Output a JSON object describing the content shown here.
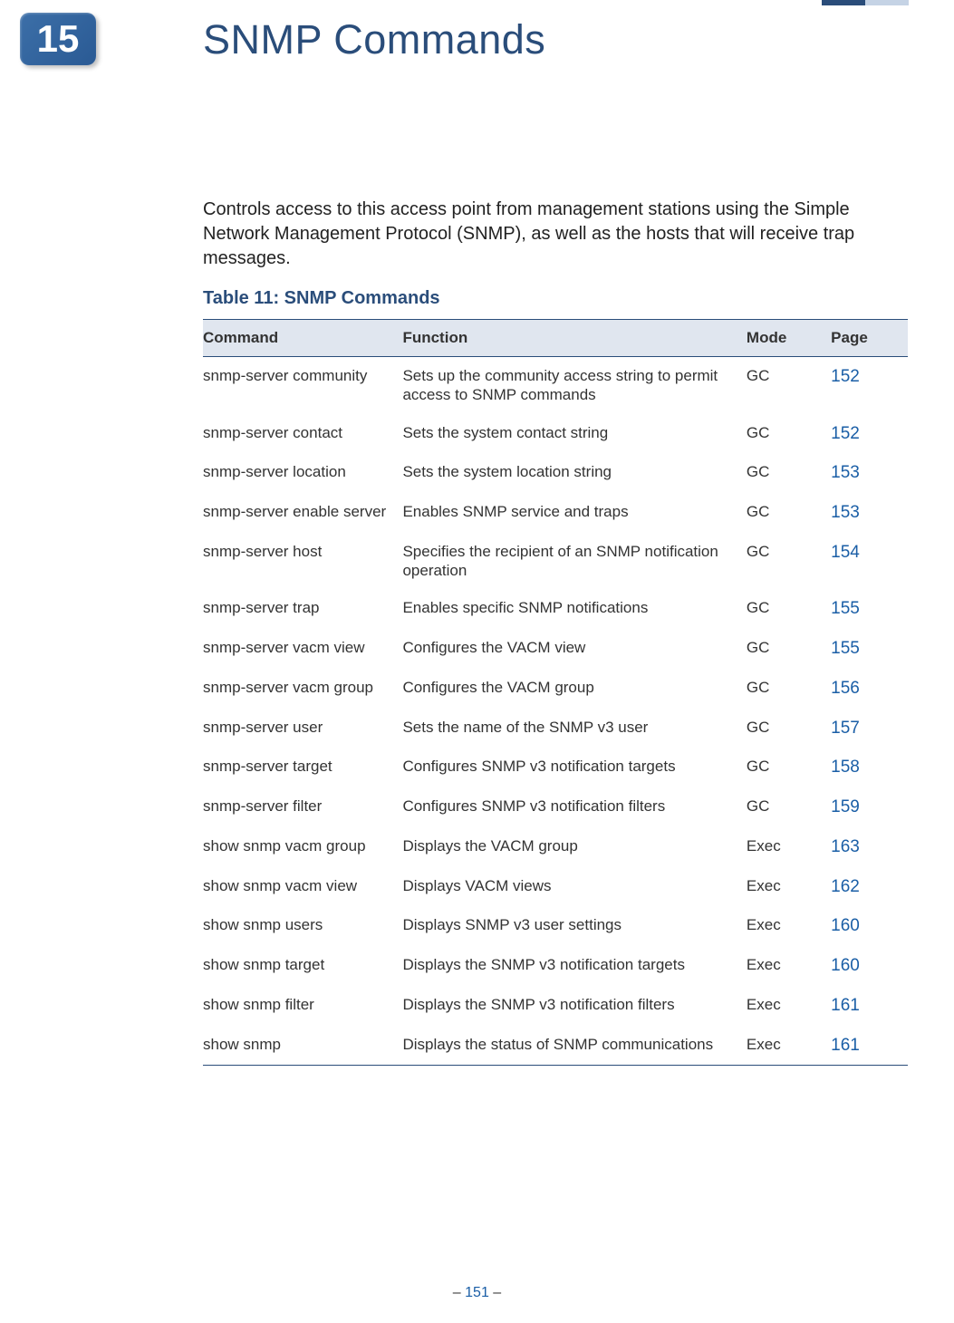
{
  "chapter": {
    "number": "15",
    "title": "SNMP Commands"
  },
  "intro": "Controls access to this access point from management stations using the Simple Network Management Protocol (SNMP), as well as the hosts that will receive trap messages.",
  "table": {
    "caption": "Table 11: SNMP Commands",
    "headers": {
      "command": "Command",
      "function": "Function",
      "mode": "Mode",
      "page": "Page"
    },
    "rows": [
      {
        "command": "snmp-server community",
        "function": "Sets up the community access string to permit access to SNMP commands",
        "mode": "GC",
        "page": "152"
      },
      {
        "command": "snmp-server contact",
        "function": "Sets the system contact string",
        "mode": "GC",
        "page": "152"
      },
      {
        "command": "snmp-server location",
        "function": "Sets the system location string",
        "mode": "GC",
        "page": "153"
      },
      {
        "command": "snmp-server enable server",
        "function": "Enables SNMP service and traps",
        "mode": "GC",
        "page": "153"
      },
      {
        "command": "snmp-server host",
        "function": "Specifies the recipient of an SNMP notification operation",
        "mode": "GC",
        "page": "154"
      },
      {
        "command": "snmp-server trap",
        "function": "Enables specific SNMP notifications",
        "mode": "GC",
        "page": "155"
      },
      {
        "command": "snmp-server vacm view",
        "function": "Configures the VACM view",
        "mode": "GC",
        "page": "155"
      },
      {
        "command": "snmp-server vacm group",
        "function": "Configures the VACM group",
        "mode": "GC",
        "page": "156"
      },
      {
        "command": "snmp-server user",
        "function": "Sets the name of the SNMP v3 user",
        "mode": "GC",
        "page": "157"
      },
      {
        "command": "snmp-server target",
        "function": "Configures SNMP v3 notification targets",
        "mode": "GC",
        "page": "158"
      },
      {
        "command": "snmp-server filter",
        "function": "Configures SNMP v3 notification filters",
        "mode": "GC",
        "page": "159"
      },
      {
        "command": "show snmp vacm group",
        "function": "Displays the VACM group",
        "mode": "Exec",
        "page": "163"
      },
      {
        "command": "show snmp vacm view",
        "function": "Displays VACM views",
        "mode": "Exec",
        "page": "162"
      },
      {
        "command": "show snmp users",
        "function": "Displays SNMP v3 user settings",
        "mode": "Exec",
        "page": "160"
      },
      {
        "command": "show snmp target",
        "function": "Displays the SNMP v3 notification targets",
        "mode": "Exec",
        "page": "160"
      },
      {
        "command": "show snmp filter",
        "function": "Displays the SNMP v3 notification filters",
        "mode": "Exec",
        "page": "161"
      },
      {
        "command": "show snmp",
        "function": "Displays the status of SNMP communications",
        "mode": "Exec",
        "page": "161"
      }
    ]
  },
  "footer": {
    "dash": "–  ",
    "page": "151",
    "dash2": "  –"
  }
}
